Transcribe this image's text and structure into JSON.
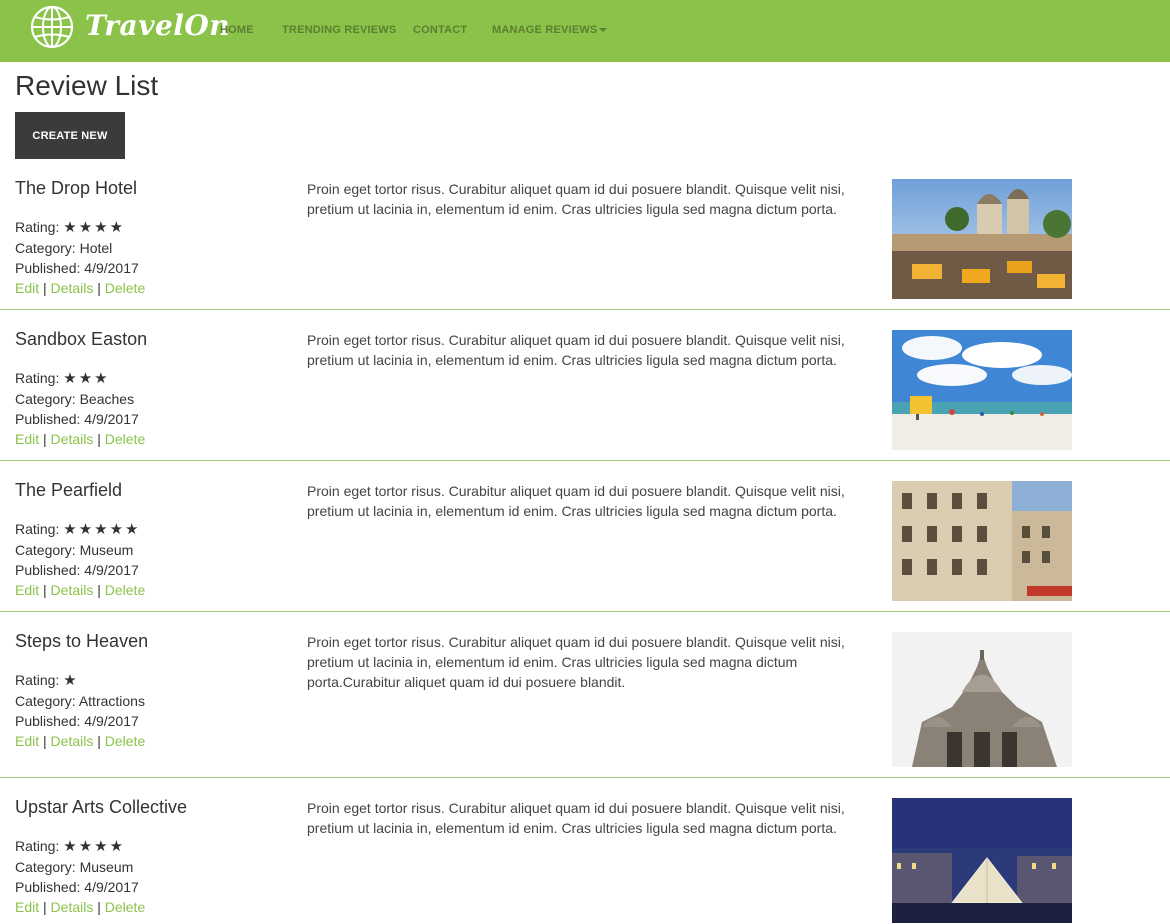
{
  "brand": {
    "name": "TravelOn",
    "icon": "globe-icon",
    "color": "#8bc34a"
  },
  "nav": {
    "home": "HOME",
    "trending": "TRENDING REVIEWS",
    "contact": "CONTACT",
    "manage": "MANAGE REVIEWS"
  },
  "page": {
    "title": "Review List",
    "create_label": "CREATE NEW"
  },
  "labels": {
    "rating": "Rating:",
    "category": "Category:",
    "published": "Published:",
    "edit": "Edit",
    "details": "Details",
    "delete": "Delete",
    "sep": "|"
  },
  "reviews": [
    {
      "title": "The Drop Hotel",
      "stars": "★★★★",
      "rating": 4,
      "category": "Hotel",
      "published": "4/9/2017",
      "description": "Proin eget tortor risus. Curabitur aliquet quam id dui posuere blandit. Quisque velit nisi, pretium ut lacinia in, elementum id enim. Cras ultricies ligula sed magna dictum porta."
    },
    {
      "title": "Sandbox Easton",
      "stars": "★★★",
      "rating": 3,
      "category": "Beaches",
      "published": "4/9/2017",
      "description": "Proin eget tortor risus. Curabitur aliquet quam id dui posuere blandit. Quisque velit nisi, pretium ut lacinia in, elementum id enim. Cras ultricies ligula sed magna dictum porta."
    },
    {
      "title": "The Pearfield",
      "stars": "★★★★★",
      "rating": 5,
      "category": "Museum",
      "published": "4/9/2017",
      "description": "Proin eget tortor risus. Curabitur aliquet quam id dui posuere blandit. Quisque velit nisi, pretium ut lacinia in, elementum id enim. Cras ultricies ligula sed magna dictum porta."
    },
    {
      "title": "Steps to Heaven",
      "stars": "★",
      "rating": 1,
      "category": "Attractions",
      "published": "4/9/2017",
      "description": "Proin eget tortor risus. Curabitur aliquet quam id dui posuere blandit. Quisque velit nisi, pretium ut lacinia in, elementum id enim. Cras ultricies ligula sed magna dictum porta.Curabitur aliquet quam id dui posuere blandit."
    },
    {
      "title": "Upstar Arts Collective",
      "stars": "★★★★",
      "rating": 4,
      "category": "Museum",
      "published": "4/9/2017",
      "description": "Proin eget tortor risus. Curabitur aliquet quam id dui posuere blandit. Quisque velit nisi, pretium ut lacinia in, elementum id enim. Cras ultricies ligula sed magna dictum porta."
    }
  ]
}
